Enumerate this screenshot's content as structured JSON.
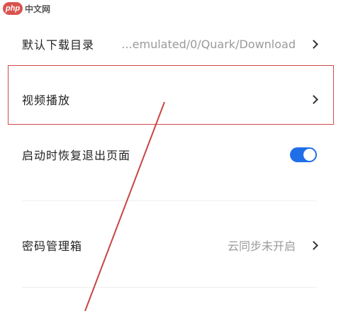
{
  "watermark": {
    "logo": "php",
    "text": "中文网"
  },
  "settings": {
    "download_dir": {
      "label": "默认下载目录",
      "value": "...emulated/0/Quark/Download",
      "icon": "chevron-right-icon"
    },
    "video_playback": {
      "label": "视频播放",
      "icon": "chevron-right-icon"
    },
    "restore_pages": {
      "label": "启动时恢复退出页面",
      "toggle_on": true,
      "toggle_color": "#1f6fe8"
    },
    "password_manager": {
      "label": "密码管理箱",
      "value": "云同步未开启",
      "icon": "chevron-right-icon"
    }
  },
  "annotation": {
    "highlight_color": "#d04a4a"
  }
}
